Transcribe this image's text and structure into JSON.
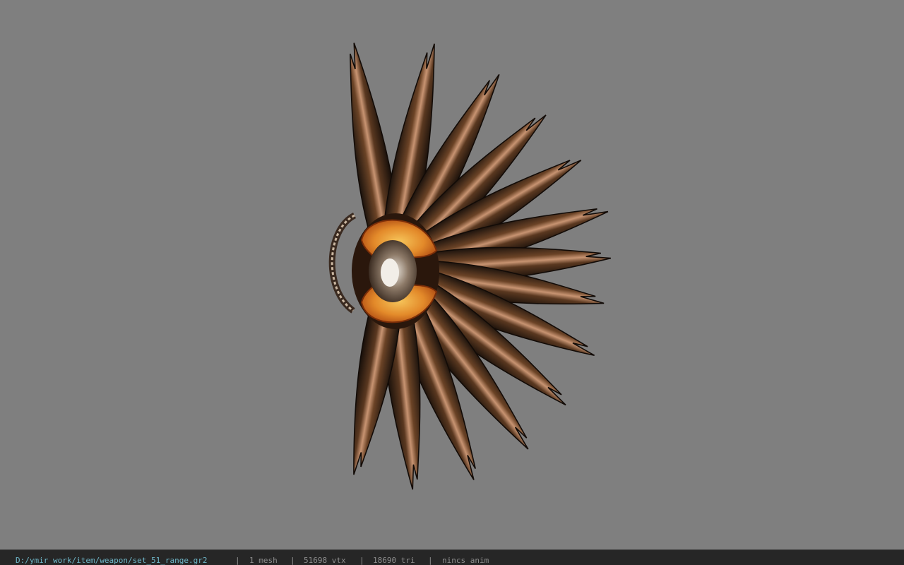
{
  "status": {
    "file_path": "D:/ymir work/item/weapon/set_51_range.gr2",
    "mesh_count": "1 mesh",
    "vertex_count": "51698 vtx",
    "triangle_count": "18690 tri",
    "anim": "nincs anim",
    "separator": "|"
  },
  "colors": {
    "background": "#7f7f7f",
    "statusbar": "#262626",
    "path_text": "#6fb7c9",
    "status_text": "#8e8e8e",
    "blade_dark": "#241810",
    "blade_highlight": "#b98660",
    "center_orange": "#d9761f"
  }
}
